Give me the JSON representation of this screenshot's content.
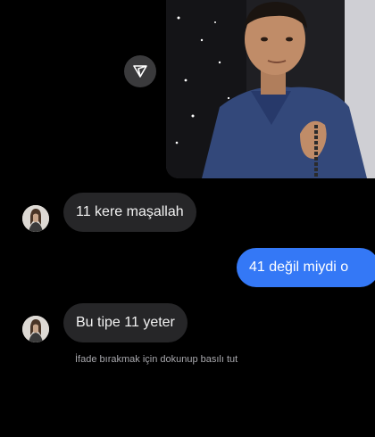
{
  "shared_post": {
    "share_icon": "send-triangle-icon"
  },
  "messages": [
    {
      "sender": "contact",
      "text": "11 kere maşallah"
    },
    {
      "sender": "me",
      "text": "41 değil miydi o"
    },
    {
      "sender": "contact",
      "text": "Bu tipe 11 yeter"
    }
  ],
  "reaction_hint": "İfade bırakmak için dokunup basılı tut",
  "colors": {
    "background": "#000000",
    "incoming_bubble": "#262628",
    "outgoing_bubble": "#3478f6"
  }
}
